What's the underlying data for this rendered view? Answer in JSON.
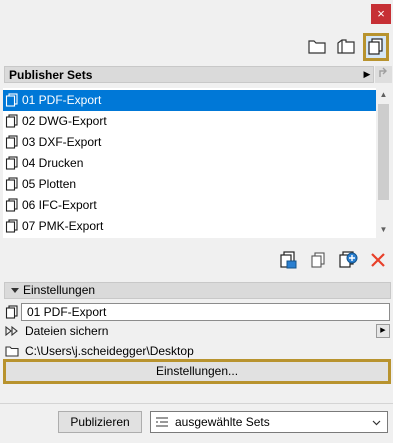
{
  "window": {
    "close_glyph": "×"
  },
  "toolbar": {
    "icons": [
      "folder-icon",
      "open-folder-icon",
      "publisher-sets-icon"
    ],
    "active_icon": "publisher-sets-icon"
  },
  "publisher_sets": {
    "header": "Publisher Sets",
    "items": [
      "01 PDF-Export",
      "02 DWG-Export",
      "03 DXF-Export",
      "04 Drucken",
      "05 Plotten",
      "06 IFC-Export",
      "07 PMK-Export"
    ],
    "selected_index": 0
  },
  "actions": {
    "icons": [
      "new-set-icon",
      "duplicate-set-icon",
      "add-set-icon",
      "delete-icon"
    ]
  },
  "settings": {
    "header": "Einstellungen",
    "set_name": "01 PDF-Export",
    "save_files_label": "Dateien sichern",
    "path": "C:\\Users\\j.scheidegger\\Desktop",
    "settings_button": "Einstellungen..."
  },
  "footer": {
    "publish_button": "Publizieren",
    "scope_dropdown": "ausgewählte Sets"
  },
  "colors": {
    "selection": "#0078d7",
    "highlight_border": "#b8932e",
    "close_red": "#c62f34",
    "delete_red": "#e8402a"
  }
}
